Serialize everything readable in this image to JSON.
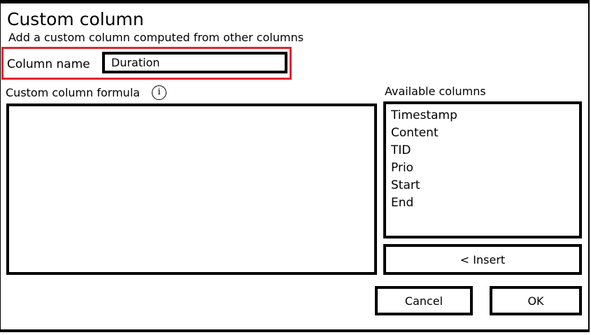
{
  "dialog": {
    "title": "Custom column",
    "subtitle": "Add a custom column computed from other columns"
  },
  "column_name": {
    "label": "Column name",
    "value": "Duration"
  },
  "formula": {
    "label": "Custom column formula",
    "info_icon": "i",
    "value": ""
  },
  "available_columns": {
    "label": "Available columns",
    "items": [
      "Timestamp",
      "Content",
      "TID",
      "Prio",
      "Start",
      "End"
    ]
  },
  "buttons": {
    "insert_label": "< Insert",
    "cancel_label": "Cancel",
    "ok_label": "OK"
  },
  "colors": {
    "highlight": "#e0252f",
    "border": "#000000",
    "background": "#ffffff"
  },
  "icons": {
    "info": "info-circle-icon"
  }
}
